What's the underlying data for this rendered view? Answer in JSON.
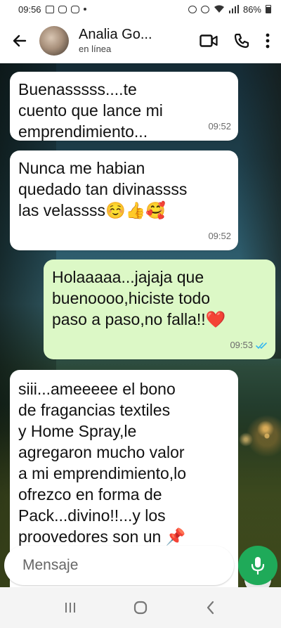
{
  "status_bar": {
    "time": "09:56",
    "battery": "86%"
  },
  "header": {
    "contact_name": "Analia Go...",
    "status": "en línea"
  },
  "messages": [
    {
      "dir": "in",
      "text": "Buenasssss....te\ncuento que lance mi\nemprendimiento...",
      "time": "09:52"
    },
    {
      "dir": "in",
      "text": "Nunca me habian\nquedado tan divinassss\nlas velassss☺️👍🥰",
      "time": "09:52"
    },
    {
      "dir": "out",
      "text": "Holaaaaa...jajaja que\nbuenoooo,hiciste todo\npaso a paso,no falla!!❤️",
      "time": "09:53",
      "read": true
    },
    {
      "dir": "in",
      "text": "siii...ameeeee el bono\nde fragancias textiles\ny Home Spray,le\nagregaron mucho valor\na mi emprendimiento,lo\nofrezco en forma de\nPack...divino!!...y los\nproovedores son un 📌"
    }
  ],
  "input": {
    "placeholder": "Mensaje",
    "value": ""
  },
  "colors": {
    "outgoing_bubble": "#dcf8c6",
    "incoming_bubble": "#ffffff",
    "mic_button": "#1faa59",
    "read_ticks": "#34b7f1"
  }
}
